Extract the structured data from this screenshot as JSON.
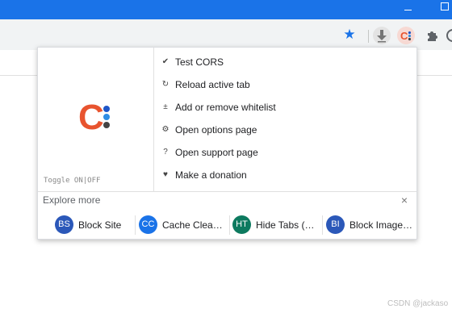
{
  "toolbar": {
    "star_icon": "bookmark-star-icon",
    "cors_icon_text": "C:"
  },
  "popup": {
    "logo_text": "C",
    "toggle_text": "Toggle ON|OFF",
    "menu": [
      {
        "icon": "✔",
        "icon_name": "check-icon",
        "label": "Test CORS"
      },
      {
        "icon": "↻",
        "icon_name": "reload-icon",
        "label": "Reload active tab"
      },
      {
        "icon": "±",
        "icon_name": "plus-minus-icon",
        "label": "Add or remove whitelist"
      },
      {
        "icon": "⚙",
        "icon_name": "gear-icon",
        "label": "Open options page"
      },
      {
        "icon": "?",
        "icon_name": "question-icon",
        "label": "Open support page"
      },
      {
        "icon": "♥",
        "icon_name": "heart-icon",
        "label": "Make a donation"
      }
    ],
    "explore_title": "Explore more",
    "close_icon": "×",
    "extensions": [
      {
        "badge": "BS",
        "name": "Block Site",
        "color": "#2b58b9"
      },
      {
        "badge": "CC",
        "name": "Cache Clea…",
        "color": "#1a73e8"
      },
      {
        "badge": "HT",
        "name": "Hide Tabs (…",
        "color": "#0d7a5f"
      },
      {
        "badge": "BI",
        "name": "Block Image…",
        "color": "#2b58b9"
      }
    ]
  },
  "colors": {
    "titlebar": "#1a73e8",
    "logo_orange": "#e8542f",
    "logo_dot_top": "#1e56c8",
    "logo_dot_mid": "#2f8de4",
    "logo_dot_bottom": "#444444"
  },
  "watermark": "CSDN @jackaso"
}
